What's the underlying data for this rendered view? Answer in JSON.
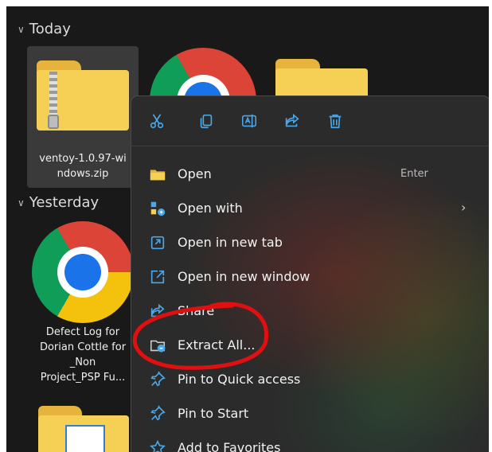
{
  "groups": {
    "today": "Today",
    "yesterday": "Yesterday"
  },
  "files": {
    "zip": {
      "label_line1": "ventoy-1.0.97-wi",
      "label_line2": "ndows.zip"
    },
    "defect_log": {
      "label_line1": "Defect Log for",
      "label_line2": "Dorian Cottle for",
      "label_line3": "_Non",
      "label_line4": "Project_PSP Fu..."
    }
  },
  "context_menu": {
    "toolbar": [
      "cut-icon",
      "copy-icon",
      "rename-icon",
      "share-icon",
      "delete-icon"
    ],
    "items": [
      {
        "label": "Open",
        "shortcut": "Enter",
        "icon": "folder-open-icon"
      },
      {
        "label": "Open with",
        "icon": "open-with-icon",
        "submenu": "›"
      },
      {
        "label": "Open in new tab",
        "icon": "new-tab-icon"
      },
      {
        "label": "Open in new window",
        "icon": "new-window-icon"
      },
      {
        "label": "Share",
        "icon": "share-icon"
      },
      {
        "label": "Extract All...",
        "icon": "extract-icon"
      },
      {
        "label": "Pin to Quick access",
        "icon": "pin-icon"
      },
      {
        "label": "Pin to Start",
        "icon": "pin-icon"
      },
      {
        "label": "Add to Favorites",
        "icon": "star-icon"
      }
    ]
  },
  "colors": {
    "window_bg": "#191919",
    "menu_bg": "#2b2b2b",
    "accent_blue": "#4aa8e8",
    "folder_yellow": "#f6cf55",
    "annotation_red": "#e01010"
  }
}
